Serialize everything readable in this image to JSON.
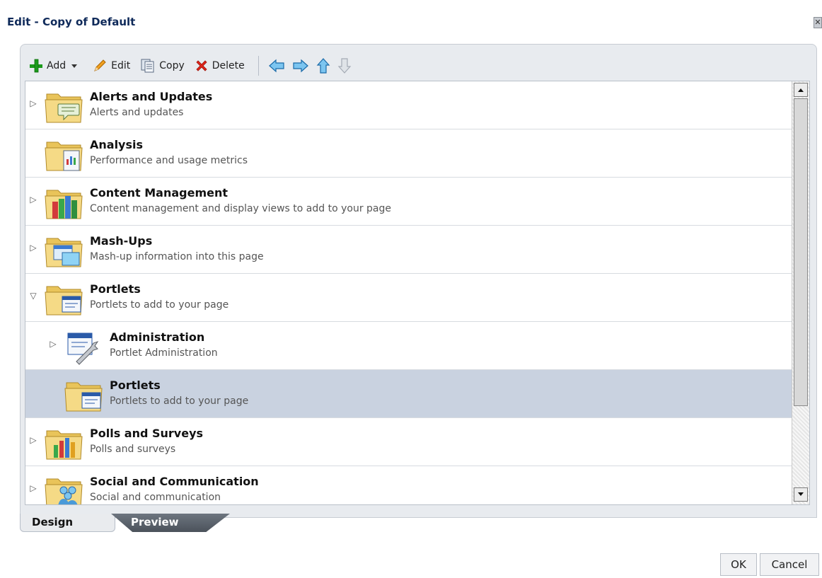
{
  "dialog": {
    "title": "Edit - Copy of Default",
    "close_glyph": "✕"
  },
  "toolbar": {
    "add_label": "Add",
    "edit_label": "Edit",
    "copy_label": "Copy",
    "delete_label": "Delete",
    "icons": [
      "add-icon",
      "dropdown-icon",
      "edit-icon",
      "copy-icon",
      "delete-icon",
      "arrow-left-icon",
      "arrow-right-icon",
      "arrow-up-icon",
      "arrow-down-icon"
    ]
  },
  "tree": {
    "items": [
      {
        "title": "Alerts and Updates",
        "description": "Alerts and updates",
        "expander": "collapsed",
        "icon": "alerts-folder-icon"
      },
      {
        "title": "Analysis",
        "description": "Performance and usage metrics",
        "expander": "none",
        "icon": "analysis-folder-icon"
      },
      {
        "title": "Content Management",
        "description": "Content management and display views to add to your page",
        "expander": "collapsed",
        "icon": "content-folder-icon"
      },
      {
        "title": "Mash-Ups",
        "description": "Mash-up information into this page",
        "expander": "collapsed",
        "icon": "mashup-folder-icon"
      },
      {
        "title": "Portlets",
        "description": "Portlets to add to your page",
        "expander": "expanded",
        "icon": "portlets-folder-icon"
      },
      {
        "title": "Administration",
        "description": "Portlet Administration",
        "expander": "collapsed",
        "icon": "administration-icon"
      },
      {
        "title": "Portlets",
        "description": "Portlets to add to your page",
        "expander": "none",
        "icon": "portlets-folder-icon"
      },
      {
        "title": "Polls and Surveys",
        "description": "Polls and surveys",
        "expander": "collapsed",
        "icon": "polls-folder-icon"
      },
      {
        "title": "Social and Communication",
        "description": "Social and communication",
        "expander": "collapsed",
        "icon": "social-folder-icon"
      }
    ]
  },
  "tabs": {
    "design_label": "Design",
    "preview_label": "Preview",
    "active": "Design"
  },
  "buttons": {
    "ok_label": "OK",
    "cancel_label": "Cancel"
  },
  "colors": {
    "selected_row": "#c9d2e0",
    "title_text": "#0f2a5a",
    "folder_yellow": "#e9c45a"
  }
}
